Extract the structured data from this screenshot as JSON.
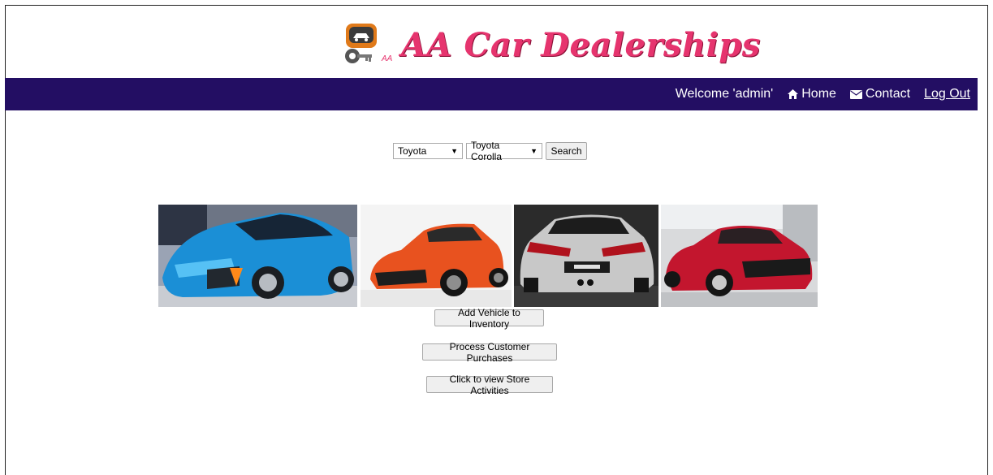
{
  "brand": {
    "title": "AA Car Dealerships",
    "logo_mark": "AA"
  },
  "nav": {
    "welcome": "Welcome 'admin'",
    "home": "Home",
    "contact": "Contact",
    "logout": "Log Out"
  },
  "search": {
    "make": "Toyota",
    "model": "Toyota Corolla",
    "button": "Search"
  },
  "gallery": [
    {
      "name": "blue-concept-car",
      "color": "#1b8fd6"
    },
    {
      "name": "orange-corolla",
      "color": "#e8521f"
    },
    {
      "name": "silver-civic-rear",
      "color": "#c8c8c8"
    },
    {
      "name": "red-accord",
      "color": "#c3162e"
    }
  ],
  "actions": {
    "add_vehicle": "Add Vehicle to Inventory",
    "process_purchases": "Process Customer Purchases",
    "view_activities": "Click to view Store Activities"
  },
  "colors": {
    "navbar": "#230e63",
    "brand": "#e6346e"
  }
}
